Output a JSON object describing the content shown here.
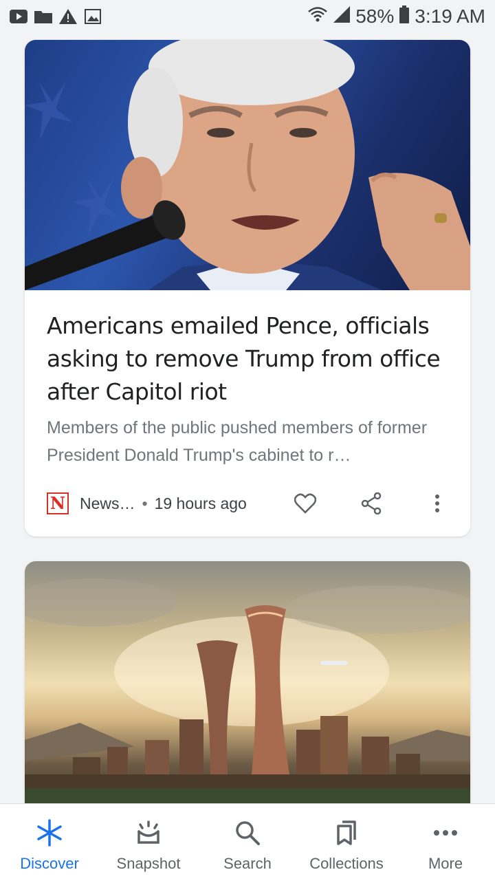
{
  "status_bar": {
    "battery": "58%",
    "time": "3:19 AM",
    "left_icons": [
      "youtube-icon",
      "folder-icon",
      "warning-icon",
      "image-icon"
    ],
    "right_icons": [
      "wifi-icon",
      "signal-icon",
      "battery-icon"
    ]
  },
  "cards": [
    {
      "headline": "Americans emailed Pence, officials asking to remove Trump from office after Capitol riot",
      "snippet": "Members of the public pushed members of former President Donald Trump's cabinet to r…",
      "publisher_logo": "N",
      "publisher": "News…",
      "separator": "•",
      "time_ago": "19 hours ago"
    }
  ],
  "bottom_nav": {
    "items": [
      {
        "label": "Discover",
        "icon": "asterisk-icon"
      },
      {
        "label": "Snapshot",
        "icon": "snapshot-icon"
      },
      {
        "label": "Search",
        "icon": "search-icon"
      },
      {
        "label": "Collections",
        "icon": "collections-icon"
      },
      {
        "label": "More",
        "icon": "more-icon"
      }
    ]
  },
  "colors": {
    "accent": "#1a73e8",
    "publisher_red": "#d93025",
    "background": "#f1f3f4"
  }
}
